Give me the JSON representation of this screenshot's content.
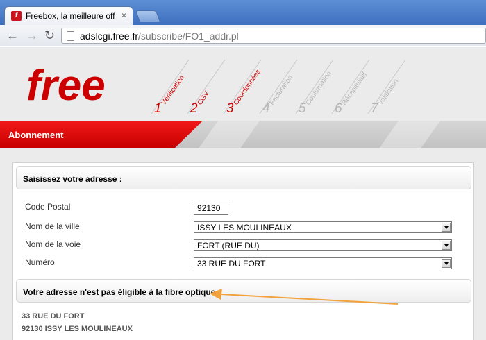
{
  "browser": {
    "tab_title": "Freebox, la meilleure offre",
    "tab_close": "×",
    "back_glyph": "←",
    "forward_glyph": "→",
    "reload_glyph": "↻",
    "url_host": "adslcgi.free.fr",
    "url_path": "/subscribe/FO1_addr.pl"
  },
  "header": {
    "logo_text": "free",
    "steps": [
      {
        "num": "1",
        "label": "Vérification",
        "active": true
      },
      {
        "num": "2",
        "label": "CGV",
        "active": true
      },
      {
        "num": "3",
        "label": "Coordonnées",
        "active": true
      },
      {
        "num": "4",
        "label": "Facturation",
        "active": false
      },
      {
        "num": "5",
        "label": "Confirmation",
        "active": false
      },
      {
        "num": "6",
        "label": "Récapitulatif",
        "active": false
      },
      {
        "num": "7",
        "label": "Validation",
        "active": false
      }
    ]
  },
  "banner": {
    "label": "Abonnement"
  },
  "address_form": {
    "title": "Saisissez votre adresse :",
    "postal_code": {
      "label": "Code Postal",
      "value": "92130"
    },
    "city": {
      "label": "Nom de la ville",
      "value": "ISSY LES MOULINEAUX"
    },
    "street": {
      "label": "Nom de la voie",
      "value": "FORT (RUE DU)"
    },
    "number": {
      "label": "Numéro",
      "value": "33 RUE DU FORT"
    }
  },
  "eligibility": {
    "title": "Votre adresse n'est pas éligible à la fibre optique :",
    "address_line1": "33 RUE DU FORT",
    "address_line2": "92130 ISSY LES MOULINEAUX"
  },
  "colors": {
    "brand_red": "#cc0000",
    "step_inactive": "#b5b5b5",
    "annotation": "#f2a23a"
  }
}
